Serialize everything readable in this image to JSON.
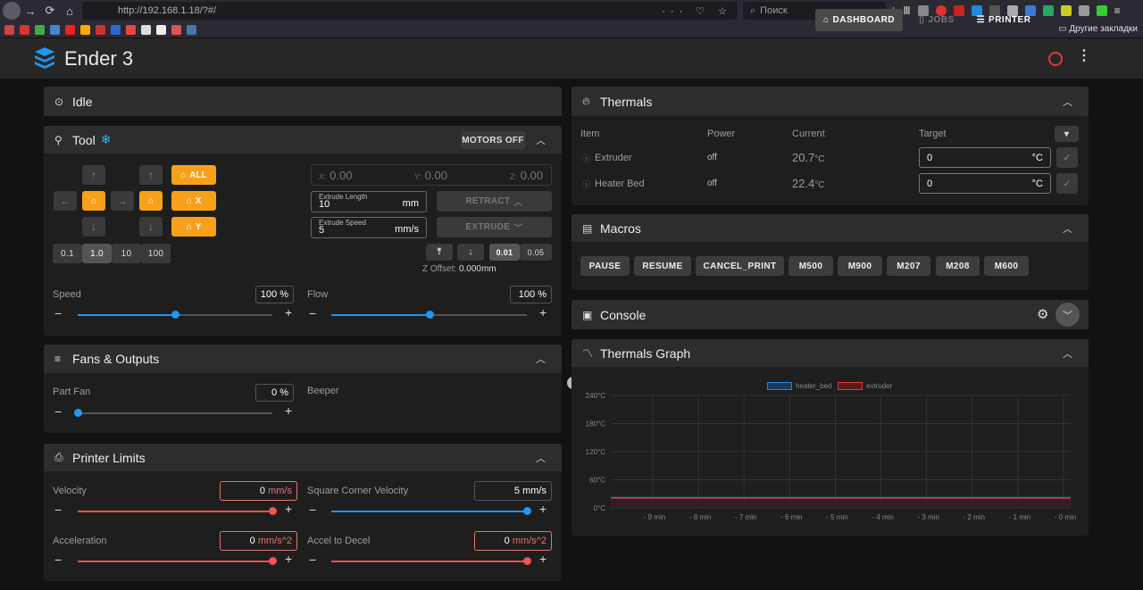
{
  "browser": {
    "url": "http://192.168.1.18/?#/",
    "search_placeholder": "Поиск",
    "other_bookmarks": "Другие закладки"
  },
  "app": {
    "title": "Ender 3",
    "nav": {
      "dashboard": "DASHBOARD",
      "jobs": "JOBS",
      "printer": "PRINTER"
    }
  },
  "status": {
    "title": "Idle"
  },
  "tool": {
    "title": "Tool",
    "motors_off": "MOTORS OFF",
    "home_all": "ALL",
    "home_x": "X",
    "home_y": "Y",
    "steps": [
      "0.1",
      "1.0",
      "10",
      "100"
    ],
    "active_step": "1.0",
    "x_label": "X:",
    "x_value": "0.00",
    "y_label": "Y:",
    "y_value": "0.00",
    "z_label": "Z:",
    "z_value": "0.00",
    "extrude_length_label": "Extrude Length",
    "extrude_length": "10",
    "extrude_length_unit": "mm",
    "extrude_speed_label": "Extrude Speed",
    "extrude_speed": "5",
    "extrude_speed_unit": "mm/s",
    "retract": "RETRACT",
    "extrude": "EXTRUDE",
    "z_steps": [
      "0.01",
      "0.05"
    ],
    "z_offset_label": "Z Offset:",
    "z_offset": "0.000mm",
    "speed_label": "Speed",
    "speed_value": "100 %",
    "speed_level": 0.5,
    "flow_label": "Flow",
    "flow_value": "100 %",
    "flow_level": 0.5
  },
  "fans": {
    "title": "Fans & Outputs",
    "part_fan_label": "Part Fan",
    "part_fan_value": "0 %",
    "part_fan_level": 0,
    "beeper_label": "Beeper"
  },
  "limits": {
    "title": "Printer Limits",
    "velocity_label": "Velocity",
    "velocity_value": "0",
    "velocity_unit": "mm/s",
    "scv_label": "Square Corner Velocity",
    "scv_value": "5",
    "scv_unit": "mm/s",
    "accel_label": "Acceleration",
    "accel_value": "0",
    "accel_unit": "mm/s^2",
    "a2d_label": "Accel to Decel",
    "a2d_value": "0",
    "a2d_unit": "mm/s^2"
  },
  "thermals": {
    "title": "Thermals",
    "col_item": "Item",
    "col_power": "Power",
    "col_current": "Current",
    "col_target": "Target",
    "rows": [
      {
        "name": "Extruder",
        "power": "off",
        "current": "20.7",
        "unit": "°C",
        "target": "0",
        "target_unit": "°C"
      },
      {
        "name": "Heater Bed",
        "power": "off",
        "current": "22.4",
        "unit": "°C",
        "target": "0",
        "target_unit": "°C"
      }
    ]
  },
  "macros": {
    "title": "Macros",
    "items": [
      "PAUSE",
      "RESUME",
      "CANCEL_PRINT",
      "M500",
      "M900",
      "M207",
      "M208",
      "M600"
    ]
  },
  "console": {
    "title": "Console"
  },
  "graph": {
    "title": "Thermals Graph"
  },
  "chart_data": {
    "type": "line",
    "title": "",
    "legend": [
      "heater_bed",
      "extruder"
    ],
    "legend_placement": "top-center",
    "y_ticks": [
      "240°C",
      "180°C",
      "120°C",
      "60°C",
      "0°C"
    ],
    "x_ticks": [
      "- 9 min",
      "- 8 min",
      "- 7 min",
      "- 6 min",
      "- 5 min",
      "- 4 min",
      "- 3 min",
      "- 2 min",
      "- 1 min",
      "- 0 min"
    ],
    "ylim": [
      0,
      240
    ],
    "series": [
      {
        "name": "heater_bed",
        "color": "#1e88e5",
        "values": [
          22.4,
          22.4,
          22.4,
          22.4,
          22.4,
          22.4,
          22.4,
          22.4,
          22.4,
          22.4
        ]
      },
      {
        "name": "extruder",
        "color": "#e53935",
        "values": [
          20.7,
          20.7,
          20.7,
          20.7,
          20.7,
          20.7,
          20.7,
          20.7,
          20.7,
          20.7
        ]
      }
    ],
    "grid": true
  }
}
